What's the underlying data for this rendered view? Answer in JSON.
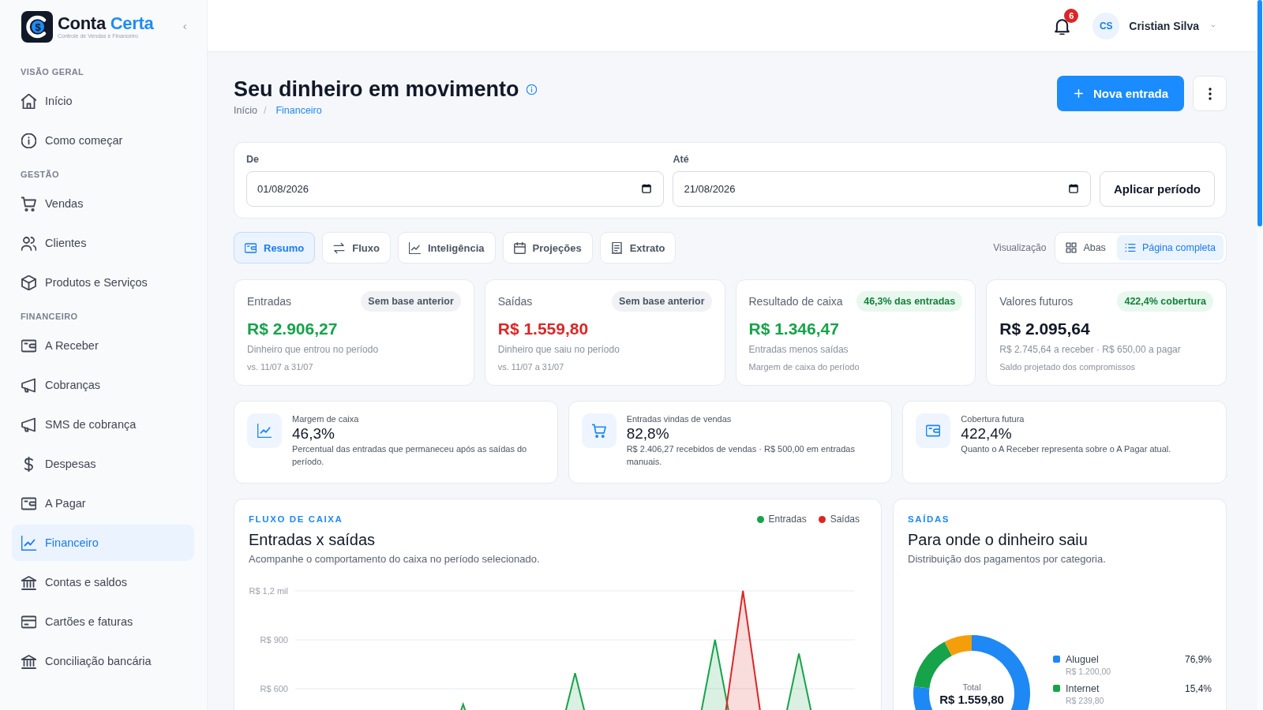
{
  "sidebar": {
    "brand": {
      "mark": "$",
      "first": "Conta",
      "second": "Certa",
      "tagline": "Controle de Vendas e Financeiro"
    },
    "sections": [
      {
        "label": "VISÃO GERAL",
        "items": [
          {
            "label": "Início",
            "selected": false
          },
          {
            "label": "Como começar",
            "selected": false
          }
        ]
      },
      {
        "label": "GESTÃO",
        "items": [
          {
            "label": "Vendas",
            "selected": false
          },
          {
            "label": "Clientes",
            "selected": false
          },
          {
            "label": "Produtos e Serviços",
            "selected": false
          }
        ]
      },
      {
        "label": "FINANCEIRO",
        "items": [
          {
            "label": "A Receber",
            "selected": false
          },
          {
            "label": "Cobranças",
            "selected": false
          },
          {
            "label": "SMS de cobrança",
            "selected": false
          },
          {
            "label": "Despesas",
            "selected": false
          },
          {
            "label": "A Pagar",
            "selected": false
          },
          {
            "label": "Financeiro",
            "selected": true
          },
          {
            "label": "Contas e saldos",
            "selected": false
          },
          {
            "label": "Cartões e faturas",
            "selected": false
          },
          {
            "label": "Conciliação bancária",
            "selected": false
          }
        ]
      }
    ]
  },
  "header": {
    "notification_count": "6",
    "user": {
      "initials": "CS",
      "name": "Cristian Silva"
    }
  },
  "page": {
    "title": "Seu dinheiro em movimento",
    "breadcrumb": [
      {
        "label": "Início",
        "selected": false
      },
      {
        "label": "Financeiro",
        "selected": true
      }
    ],
    "breadcrumb_separator": "/",
    "primary_button": "Nova entrada"
  },
  "period": {
    "from": {
      "label": "De",
      "value": "01/08/2026"
    },
    "to": {
      "label": "Até",
      "value": "21/08/2026"
    },
    "apply_button": "Aplicar período"
  },
  "tabs": [
    {
      "label": "Resumo",
      "selected": true
    },
    {
      "label": "Fluxo",
      "selected": false
    },
    {
      "label": "Inteligência",
      "selected": false
    },
    {
      "label": "Projeções",
      "selected": false
    },
    {
      "label": "Extrato",
      "selected": false
    }
  ],
  "view_toggle": {
    "label": "Visualização",
    "options": [
      {
        "label": "Abas",
        "selected": false
      },
      {
        "label": "Página completa",
        "selected": true
      }
    ]
  },
  "kpis": [
    {
      "label": "Entradas",
      "badge": {
        "text": "Sem base anterior",
        "kind": "neutral"
      },
      "value": "R$ 2.906,27",
      "color": "#16a34a",
      "description": "Dinheiro que entrou no período",
      "note": "vs. 11/07 a 31/07"
    },
    {
      "label": "Saídas",
      "badge": {
        "text": "Sem base anterior",
        "kind": "neutral"
      },
      "value": "R$ 1.559,80",
      "color": "#dc2626",
      "description": "Dinheiro que saiu no período",
      "note": "vs. 11/07 a 31/07"
    },
    {
      "label": "Resultado de caixa",
      "badge": {
        "text": "46,3% das entradas",
        "kind": "positive"
      },
      "value": "R$ 1.346,47",
      "color": "#16a34a",
      "description": "Entradas menos saídas",
      "note": "Margem de caixa do período"
    },
    {
      "label": "Valores futuros",
      "badge": {
        "text": "422,4% cobertura",
        "kind": "positive"
      },
      "value": "R$ 2.095,64",
      "color": "#111827",
      "description": "R$ 2.745,64 a receber · R$ 650,00 a pagar",
      "note": "Saldo projetado dos compromissos"
    }
  ],
  "metrics": [
    {
      "label": "Margem de caixa",
      "value": "46,3%",
      "description": "Percentual das entradas que permaneceu após as saídas do período."
    },
    {
      "label": "Entradas vindas de vendas",
      "value": "82,8%",
      "description": "R$ 2.406,27 recebidos de vendas · R$ 500,00 em entradas manuais."
    },
    {
      "label": "Cobertura futura",
      "value": "422,4%",
      "description": "Quanto o A Receber representa sobre o A Pagar atual."
    }
  ],
  "cash_flow": {
    "eyebrow": "FLUXO DE CAIXA",
    "title": "Entradas x saídas",
    "subtitle": "Acompanhe o comportamento do caixa no período selecionado.",
    "legend": [
      {
        "label": "Entradas",
        "color": "#16a34a"
      },
      {
        "label": "Saídas",
        "color": "#dc2626"
      }
    ],
    "y_axis_labels": [
      "R$ 1,2 mil",
      "R$ 900",
      "R$ 600"
    ]
  },
  "expenses": {
    "eyebrow": "SAÍDAS",
    "title": "Para onde o dinheiro saiu",
    "subtitle": "Distribuição dos pagamentos por categoria.",
    "total_label": "Total",
    "total_value": "R$ 1.559,80",
    "chart_data": {
      "type": "donut",
      "categories": [
        "Aluguel",
        "Internet",
        null
      ],
      "values": [
        76.9,
        15.4,
        7.7
      ],
      "colors": [
        "#1e88f5",
        "#16a34a",
        "#f59e0b"
      ]
    },
    "legend": [
      {
        "amount": "R$ 1.200,00",
        "percent": "76,9%"
      },
      {
        "amount": "R$ 239,80",
        "percent": "15,4%"
      }
    ]
  }
}
